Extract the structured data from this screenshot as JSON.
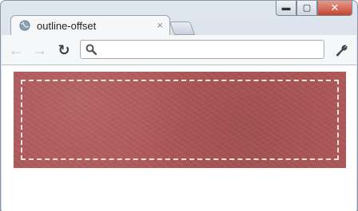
{
  "tab": {
    "title": "outline-offset",
    "close_glyph": "×",
    "icon": "globe-icon"
  },
  "window_controls": {
    "minimize": "▬",
    "maximize": "▢",
    "close": "✕"
  },
  "toolbar": {
    "back_glyph": "←",
    "forward_glyph": "→",
    "reload_glyph": "↻",
    "address_value": "",
    "address_placeholder": "",
    "settings_icon": "wrench-icon"
  },
  "colors": {
    "leather": "#b0585a",
    "dashed_outline": "#f3e6d8"
  }
}
